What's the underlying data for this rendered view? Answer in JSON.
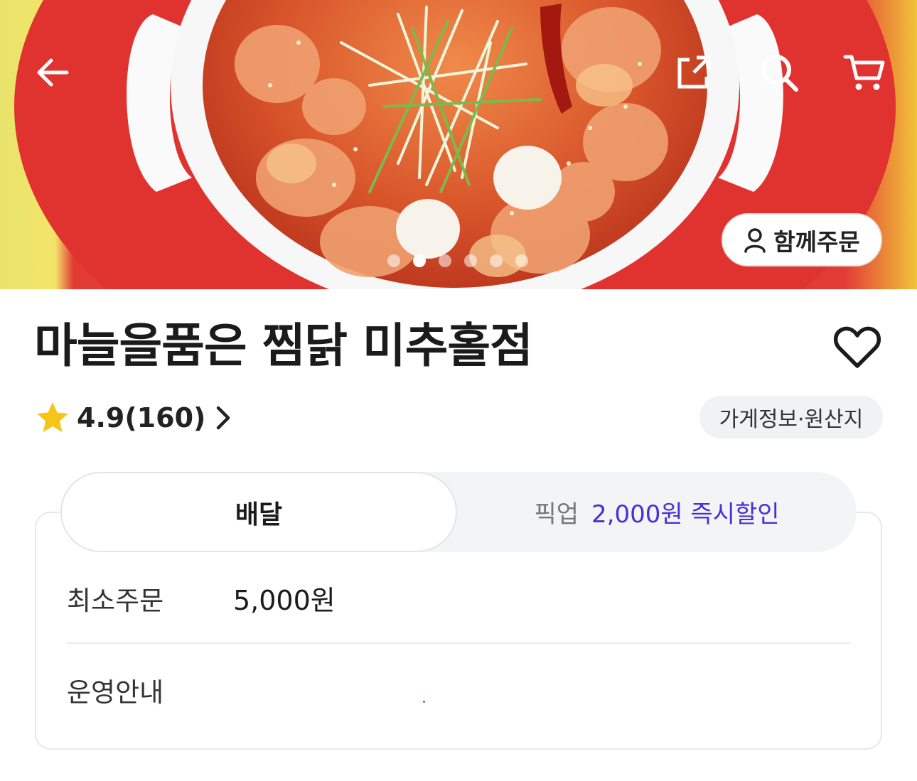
{
  "hero": {
    "together_order_label": "함께주문",
    "slide_count": 6,
    "active_slide": 2
  },
  "store": {
    "name": "마늘을품은 찜닭 미추홀점",
    "rating": "4.9(160)",
    "info_chip_label": "가게정보·원산지"
  },
  "order_tabs": {
    "delivery_label": "배달",
    "pickup_label": "픽업",
    "pickup_promo": "2,000원 즉시할인",
    "selected": "배달"
  },
  "delivery_info": {
    "min_order_label": "최소주문",
    "min_order_value": "5,000원",
    "operation_label": "운영안내"
  },
  "colors": {
    "accent_purple": "#4a2fd6",
    "star_yellow": "#f5c518",
    "hero_red": "#e23b35"
  },
  "icons": [
    "back-arrow-icon",
    "share-icon",
    "search-icon",
    "cart-icon",
    "person-icon",
    "heart-icon",
    "star-icon",
    "chevron-right-icon"
  ]
}
